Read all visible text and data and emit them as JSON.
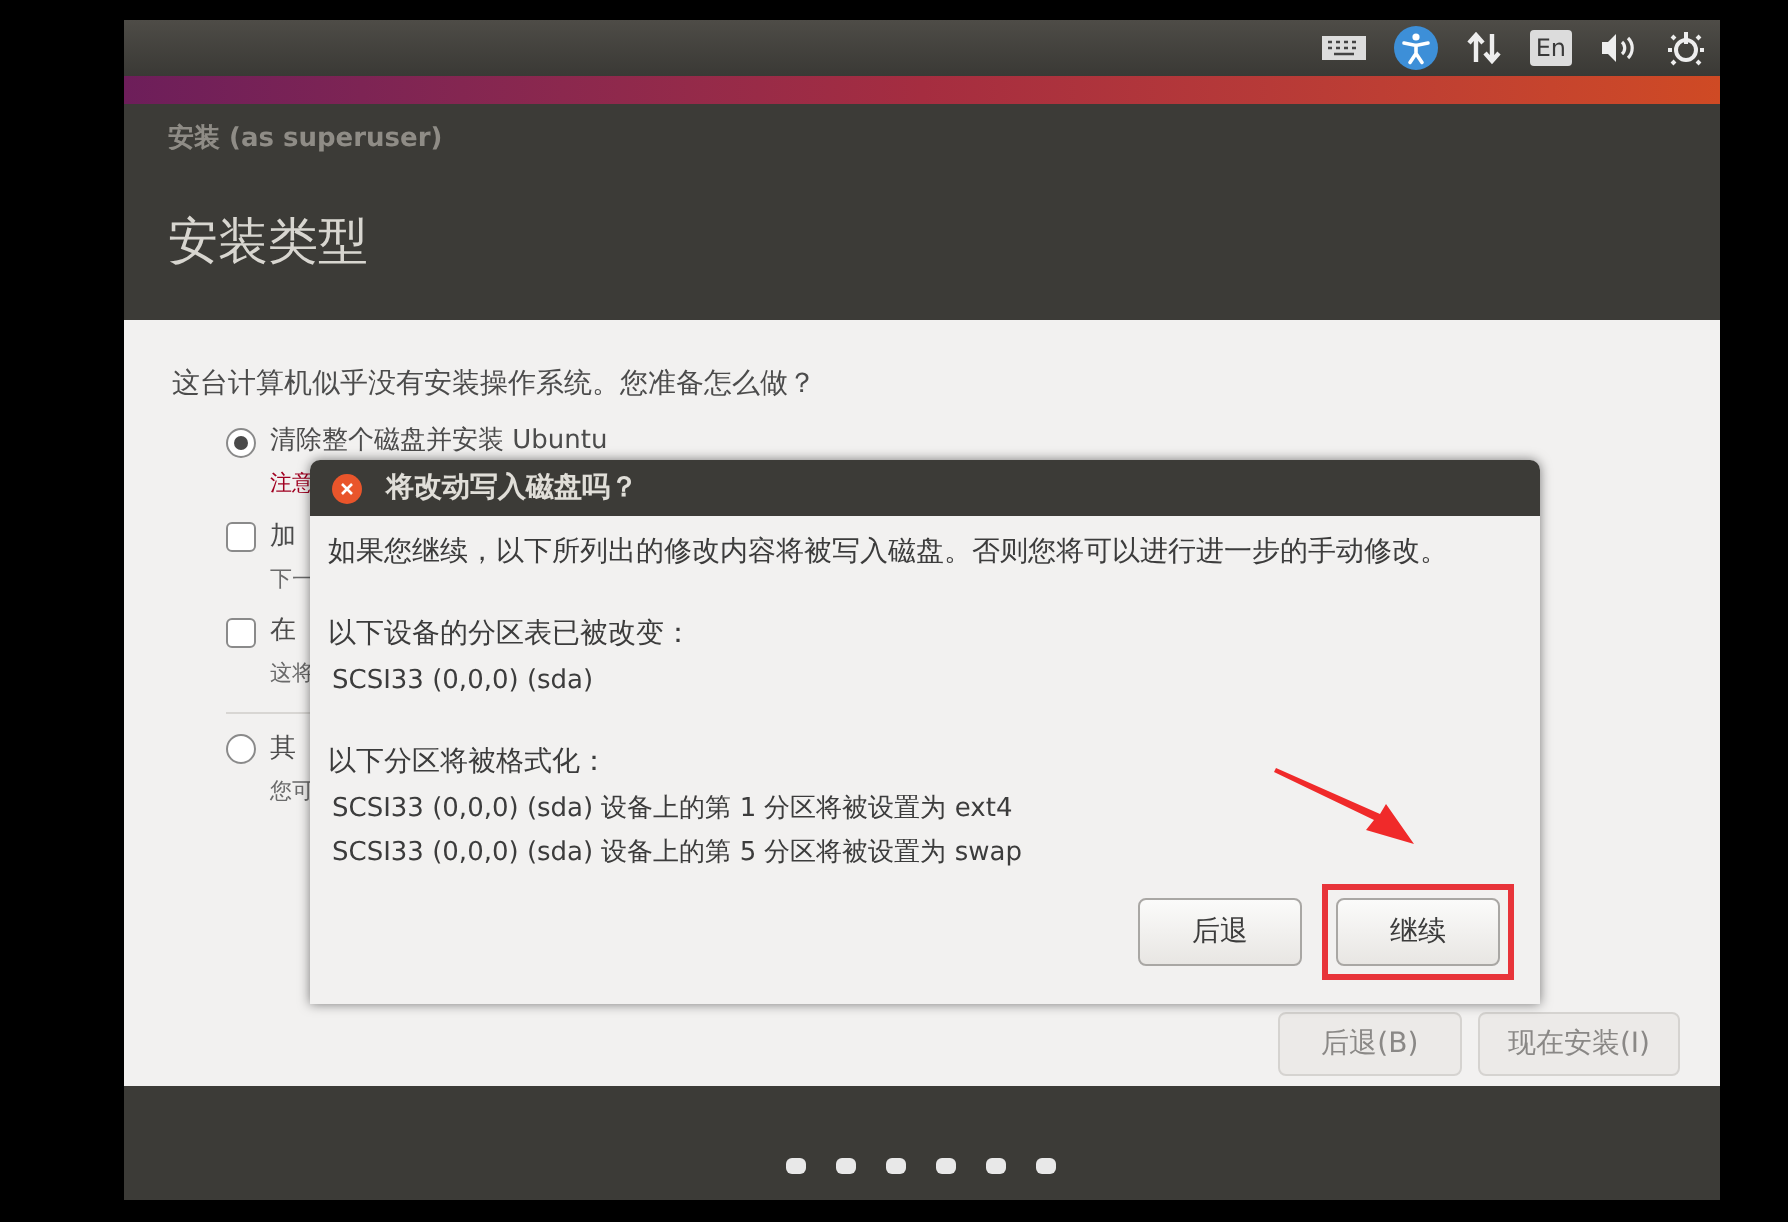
{
  "top_panel": {
    "keyboard_layout": "En"
  },
  "window": {
    "title": "安装 (as superuser)",
    "heading": "安装类型"
  },
  "question": "这台计算机似乎没有安装操作系统。您准备怎么做？",
  "options": [
    {
      "kind": "radio",
      "label": "清除整个磁盘并安装 Ubuntu",
      "selected": true,
      "note": "注意",
      "warning": true
    },
    {
      "kind": "checkbox",
      "label": "加",
      "checked": false,
      "note": "下一",
      "warning": false
    },
    {
      "kind": "checkbox",
      "label": "在",
      "checked": false,
      "note": "这将",
      "warning": false
    },
    {
      "kind": "radio",
      "label": "其",
      "selected": false,
      "note": "您可",
      "warning": false
    }
  ],
  "buttons": [
    {
      "label": "后退(B)"
    },
    {
      "label": "现在安装(I)"
    }
  ],
  "dialog": {
    "title": "将改动写入磁盘吗？",
    "message": "如果您继续，以下所列出的修改内容将被写入磁盘。否则您将可以进行进一步的手动修改。",
    "sections": [
      {
        "heading": "以下设备的分区表已被改变：",
        "items": [
          "SCSI33 (0,0,0) (sda)"
        ]
      },
      {
        "heading": "以下分区将被格式化：",
        "items": [
          "SCSI33 (0,0,0) (sda) 设备上的第 1 分区将被设置为 ext4",
          "SCSI33 (0,0,0) (sda) 设备上的第 5 分区将被设置为 swap"
        ]
      }
    ],
    "buttons": [
      {
        "label": "后退",
        "highlighted": false
      },
      {
        "label": "继续",
        "highlighted": true
      }
    ]
  }
}
